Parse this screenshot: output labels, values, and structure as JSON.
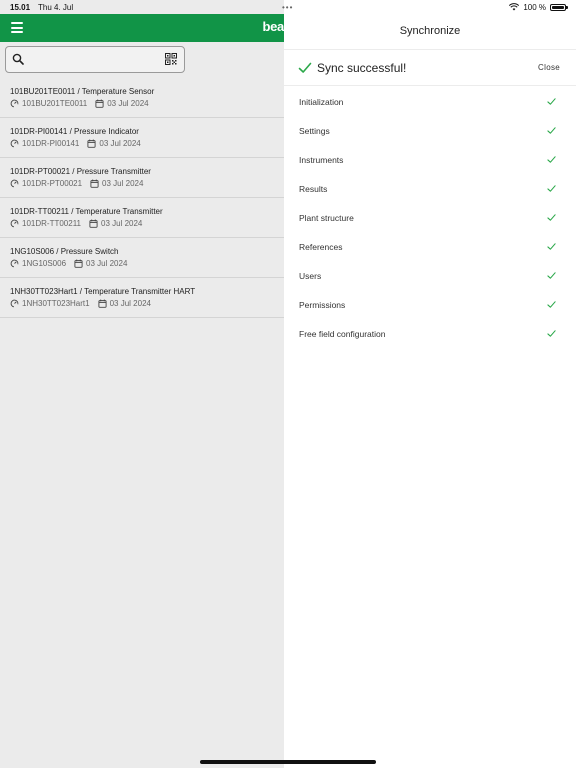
{
  "status_bar": {
    "time": "15.01",
    "date": "Thu 4. Jul",
    "dots": "•••",
    "battery_percent": "100 %"
  },
  "app": {
    "brand_text": "bea",
    "colors": {
      "header": "#119447",
      "check": "#2ba84a"
    },
    "devices": [
      {
        "title": "101BU201TE0011 / Temperature Sensor",
        "tag": "101BU201TE0011",
        "date": "03 Jul 2024"
      },
      {
        "title": "101DR-PI00141 / Pressure Indicator",
        "tag": "101DR-PI00141",
        "date": "03 Jul 2024"
      },
      {
        "title": "101DR-PT00021 / Pressure Transmitter",
        "tag": "101DR-PT00021",
        "date": "03 Jul 2024"
      },
      {
        "title": "101DR-TT00211 / Temperature Transmitter",
        "tag": "101DR-TT00211",
        "date": "03 Jul 2024"
      },
      {
        "title": "1NG10S006 / Pressure Switch",
        "tag": "1NG10S006",
        "date": "03 Jul 2024"
      },
      {
        "title": "1NH30TT023Hart1 / Temperature Transmitter HART",
        "tag": "1NH30TT023Hart1",
        "date": "03 Jul 2024"
      }
    ]
  },
  "panel": {
    "title": "Synchronize",
    "status": "Sync successful!",
    "close_label": "Close",
    "steps": [
      {
        "label": "Initialization"
      },
      {
        "label": "Settings"
      },
      {
        "label": "Instruments"
      },
      {
        "label": "Results"
      },
      {
        "label": "Plant structure"
      },
      {
        "label": "References"
      },
      {
        "label": "Users"
      },
      {
        "label": "Permissions"
      },
      {
        "label": "Free field configuration"
      }
    ]
  }
}
